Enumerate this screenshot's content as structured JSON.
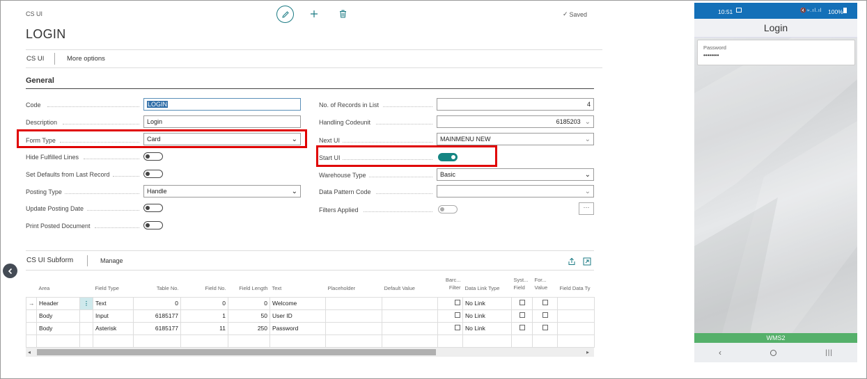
{
  "header": {
    "context_title": "CS UI",
    "page_title": "LOGIN",
    "saved_label": "Saved"
  },
  "nav": {
    "cs_ui": "CS UI",
    "more_options": "More options"
  },
  "general": {
    "section_title": "General",
    "left_fields": [
      {
        "label": "Code",
        "value": "LOGIN"
      },
      {
        "label": "Description",
        "value": "Login"
      },
      {
        "label": "Form Type",
        "value": "Card"
      },
      {
        "label": "Hide Fulfilled Lines",
        "toggle": "off"
      },
      {
        "label": "Set Defaults from Last Record",
        "toggle": "off"
      },
      {
        "label": "Posting Type",
        "value": "Handle"
      },
      {
        "label": "Update Posting Date",
        "toggle": "off"
      },
      {
        "label": "Print Posted Document",
        "toggle": "off"
      }
    ],
    "right_fields": [
      {
        "label": "No. of Records in List",
        "value": "4"
      },
      {
        "label": "Handling Codeunit",
        "value": "6185203"
      },
      {
        "label": "Next UI",
        "value": "MAINMENU NEW"
      },
      {
        "label": "Start UI",
        "toggle": "on"
      },
      {
        "label": "Warehouse Type",
        "value": "Basic"
      },
      {
        "label": "Data Pattern Code",
        "value": ""
      },
      {
        "label": "Filters Applied",
        "toggle": "off"
      }
    ]
  },
  "subform": {
    "title": "CS UI Subform",
    "manage": "Manage",
    "columns": [
      "Area",
      "Field Type",
      "Table No.",
      "Field No.",
      "Field Length",
      "Text",
      "Placeholder",
      "Default Value",
      "Barc... Filter",
      "Data Link Type",
      "Syst... Field",
      "For... Value",
      "Field Data Ty"
    ],
    "rows": [
      {
        "area": "Header",
        "field_type": "Text",
        "table_no": "0",
        "field_no": "0",
        "field_length": "0",
        "text": "Welcome",
        "link": "No Link"
      },
      {
        "area": "Body",
        "field_type": "Input",
        "table_no": "6185177",
        "field_no": "1",
        "field_length": "50",
        "text": "User ID",
        "link": "No Link"
      },
      {
        "area": "Body",
        "field_type": "Asterisk",
        "table_no": "6185177",
        "field_no": "11",
        "field_length": "250",
        "text": "Password",
        "link": "No Link"
      }
    ]
  },
  "phone": {
    "time": "10:51",
    "status_right": "100%",
    "title": "Login",
    "field_label": "Password",
    "field_value": "••••••••",
    "footer": "WMS2"
  },
  "colors": {
    "accent": "#148582",
    "highlight": "#e00000",
    "phone_status": "#1470b8",
    "phone_footer": "#55b06a"
  }
}
